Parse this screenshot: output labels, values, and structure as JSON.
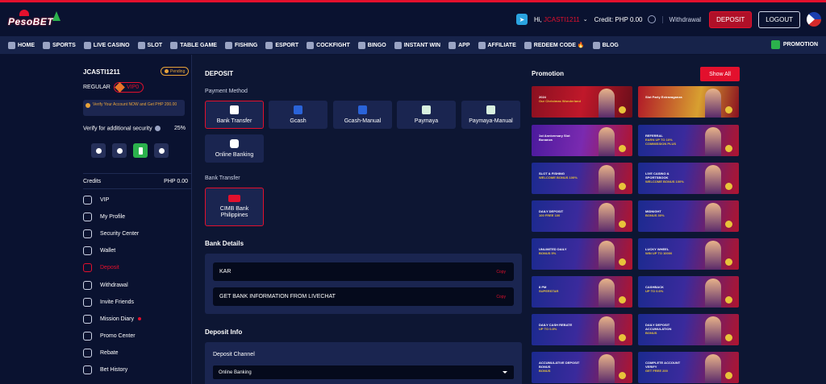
{
  "header": {
    "logo_text": "PesoBET",
    "greeting": "Hi, ",
    "username": "JCASTI1211",
    "credit_label": "Credit: PHP 0.00",
    "withdrawal": "Withdrawal",
    "deposit_button": "DEPOSIT",
    "logout_button": "LOGOUT"
  },
  "nav": {
    "items": [
      "HOME",
      "SPORTS",
      "LIVE CASINO",
      "SLOT",
      "TABLE GAME",
      "FISHING",
      "ESPORT",
      "COCKFIGHT",
      "BINGO",
      "INSTANT WIN",
      "APP",
      "AFFILIATE",
      "REDEEM CODE",
      "BLOG"
    ],
    "promotion": "PROMOTION"
  },
  "sidebar": {
    "username": "JCASTI1211",
    "pending": "Pending",
    "level": "REGULAR",
    "vip": "VIP0",
    "verify_notice": "Verify Your Account NOW and Get PHP 200.00",
    "verify_security": "Verify for additional security",
    "verify_percent": "25%",
    "credits_label": "Credits",
    "credits_value": "PHP  0.00",
    "menu": [
      "VIP",
      "My Profile",
      "Security Center",
      "Wallet",
      "Deposit",
      "Withdrawal",
      "Invite Friends",
      "Mission Diary",
      "Promo Center",
      "Rebate",
      "Bet History"
    ]
  },
  "main": {
    "title": "DEPOSIT",
    "payment_method_label": "Payment Method",
    "methods": [
      "Bank Transfer",
      "Gcash",
      "Gcash-Manual",
      "Paymaya",
      "Paymaya-Manual",
      "Online Banking"
    ],
    "bank_transfer_label": "Bank Transfer",
    "bank": "CIMB Bank Philippines",
    "bank_details_title": "Bank Details",
    "details": [
      {
        "text": "KAR",
        "copy": "Copy"
      },
      {
        "text": "GET BANK INFORMATION FROM LIVECHAT",
        "copy": "Copy"
      }
    ],
    "deposit_info_title": "Deposit Info",
    "deposit_channel_label": "Deposit Channel",
    "deposit_channel_value": "Online Banking"
  },
  "promotion": {
    "title": "Promotion",
    "show_all": "Show All",
    "banners": [
      {
        "line1": "2024",
        "line2": "Our Christmas Wonderland"
      },
      {
        "line1": "Slot Party Extravaganza",
        "line2": ""
      },
      {
        "line1": "1st Anniversary Slot Bonanza",
        "line2": ""
      },
      {
        "line1": "REFERRAL",
        "line2": "EARN UP TO 10% COMMISSION PLUS"
      },
      {
        "line1": "SLOT & FISHING",
        "line2": "WELCOME BONUS 100%"
      },
      {
        "line1": "LIVE CASINO & SPORTSBOOK",
        "line2": "WELCOME BONUS 100%"
      },
      {
        "line1": "DAILY DEPOSIT",
        "line2": "100 FREE 100"
      },
      {
        "line1": "MIDNIGHT",
        "line2": "BONUS 30%"
      },
      {
        "line1": "UNLIMITED DAILY",
        "line2": "BONUS 5%"
      },
      {
        "line1": "LUCKY WHEEL",
        "line2": "WIN UP TO 10000"
      },
      {
        "line1": "8 PM",
        "line2": "SUPERSTAR"
      },
      {
        "line1": "CASHBACK",
        "line2": "UP TO 0.6%"
      },
      {
        "line1": "DAILY CASH REBATE",
        "line2": "UP TO 0.8%"
      },
      {
        "line1": "DAILY DEPOSIT ACCUMULATION",
        "line2": "BONUS"
      },
      {
        "line1": "ACCUMULATIVE DEPOSIT BONUS",
        "line2": "BONUS"
      },
      {
        "line1": "COMPLETE ACCOUNT VERIFY",
        "line2": "GET FREE 200"
      }
    ]
  }
}
